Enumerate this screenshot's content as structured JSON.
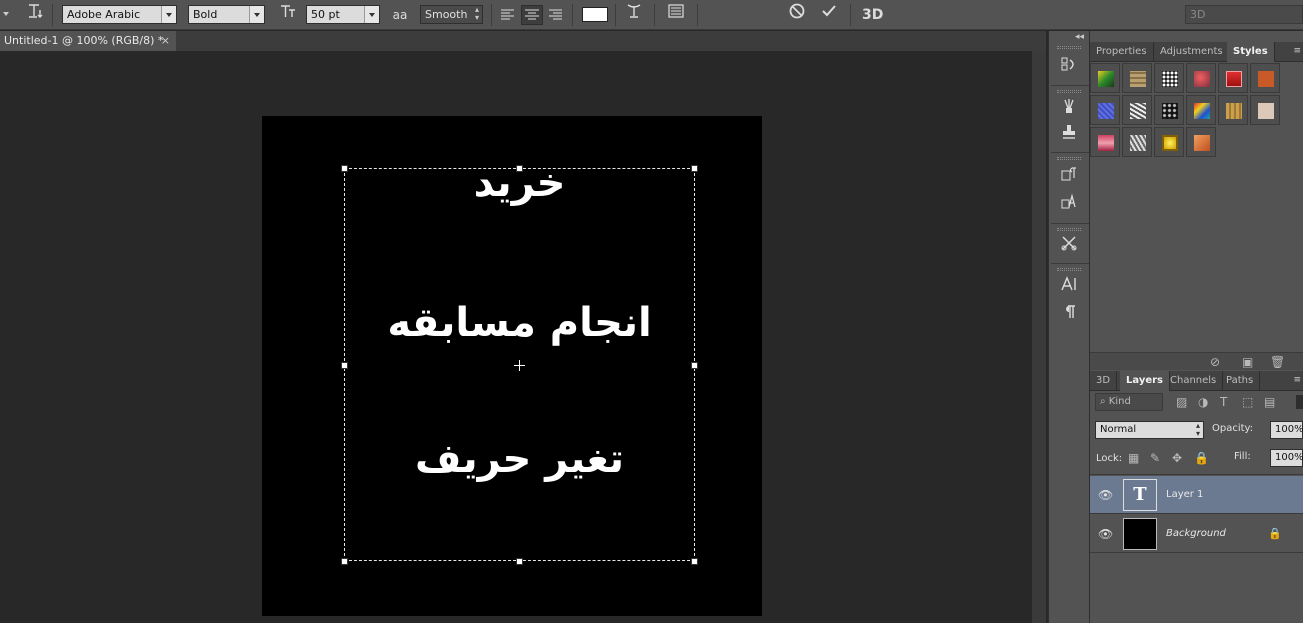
{
  "options_bar": {
    "tool_icon": "type-tool-icon",
    "font_family": "Adobe Arabic",
    "font_style": "Bold",
    "font_size": "50 pt",
    "antialias_label": "aa",
    "antialias": "Smooth",
    "text_color": "#ffffff",
    "cancel_icon": "cancel-icon",
    "commit_icon": "checkmark-icon",
    "btn_3d": "3D",
    "workspace": "3D"
  },
  "document": {
    "tab_title": "Untitled-1 @ 100% (RGB/8) *",
    "close": "×",
    "text_lines": [
      "خريد",
      "انجام مسابقه",
      "تغير حريف"
    ]
  },
  "styles_panel": {
    "tabs": [
      "Properties",
      "Adjustments",
      "Styles"
    ],
    "active_tab": "Styles"
  },
  "layers_panel": {
    "tabs": [
      "3D",
      "Layers",
      "Channels",
      "Paths"
    ],
    "active_tab": "Layers",
    "filter_kind": "Kind",
    "blend_mode": "Normal",
    "opacity_label": "Opacity:",
    "opacity": "100%",
    "lock_label": "Lock:",
    "fill_label": "Fill:",
    "fill": "100%",
    "layers": [
      {
        "name": "Layer 1",
        "type": "text",
        "thumb_glyph": "T",
        "selected": true
      },
      {
        "name": "Background",
        "type": "pixel",
        "locked": true
      }
    ]
  }
}
